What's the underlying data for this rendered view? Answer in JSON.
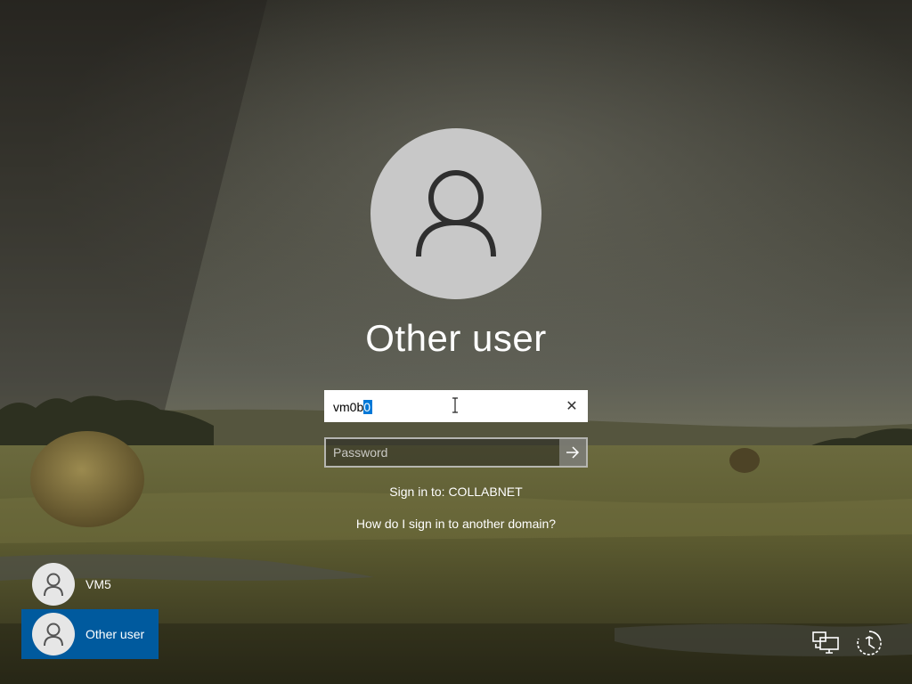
{
  "login": {
    "user_title": "Other user",
    "username_value_plain": "vm0b",
    "username_value_selected": "0",
    "clear_icon": "✕",
    "password_placeholder": "Password",
    "sign_in_to": "Sign in to: COLLABNET",
    "other_domain_link": "How do I sign in to another domain?"
  },
  "user_list": [
    {
      "label": "VM5",
      "selected": false
    },
    {
      "label": "Other user",
      "selected": true
    }
  ],
  "icons": {
    "avatar": "user-icon",
    "clear": "close-icon",
    "submit": "arrow-right-icon",
    "network": "network-icon",
    "power": "power-icon",
    "accessibility": "ease-of-access-icon"
  },
  "colors": {
    "selection": "#0078d7",
    "selected_tile": "#005a9e",
    "avatar_bg": "#c8c8c8"
  }
}
